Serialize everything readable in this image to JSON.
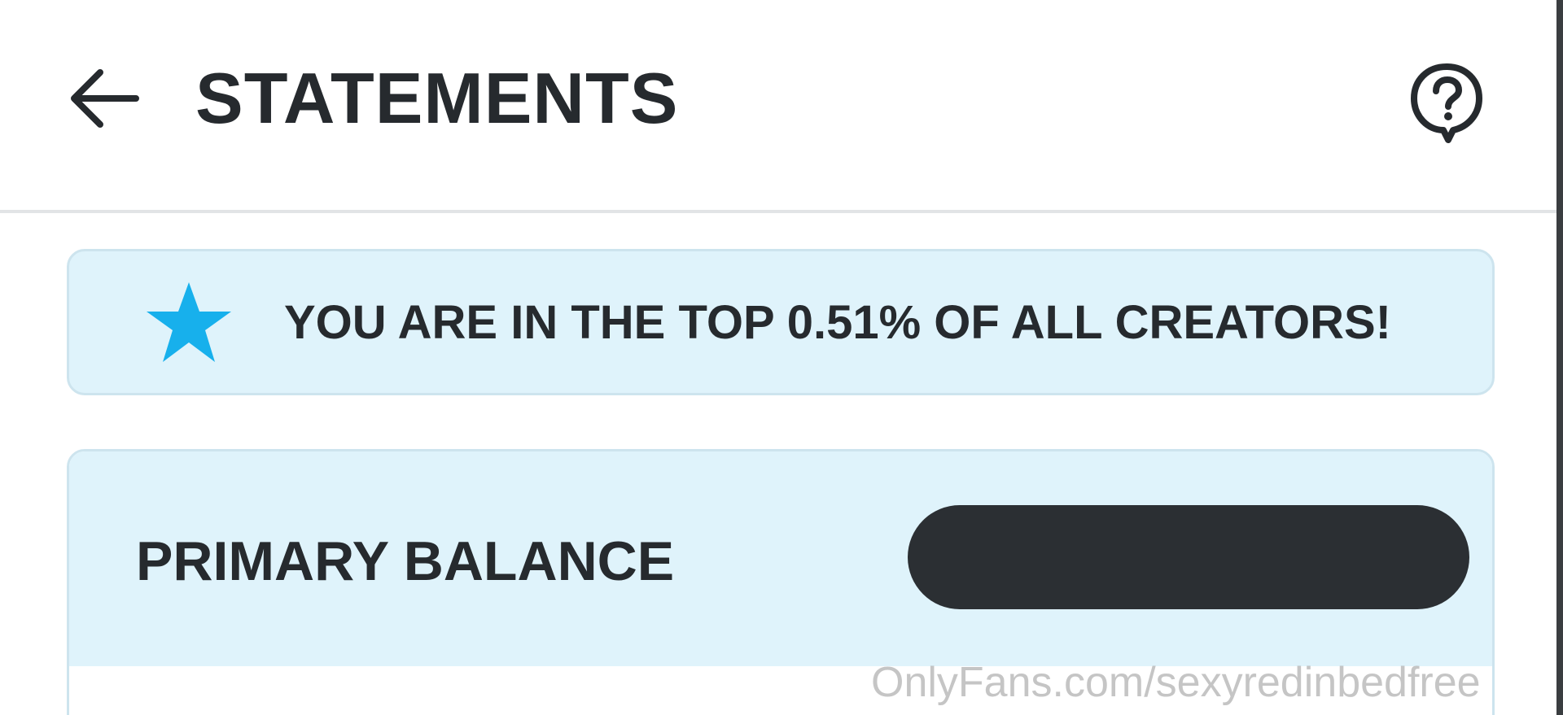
{
  "header": {
    "title": "STATEMENTS",
    "back_icon": "arrow-left-icon",
    "help_icon": "question-bubble-icon"
  },
  "rank_banner": {
    "icon": "star-icon",
    "text": "YOU ARE IN THE TOP 0.51% OF ALL CREATORS!"
  },
  "balance": {
    "label": "PRIMARY BALANCE",
    "value": ""
  },
  "watermark": {
    "text": "OnlyFans.com/sexyredinbedfree"
  },
  "colors": {
    "text": "#262a2e",
    "banner_bg": "#dff3fb",
    "banner_border": "#cde4ee",
    "star": "#17b0ec",
    "redaction": "#2b2f33"
  }
}
